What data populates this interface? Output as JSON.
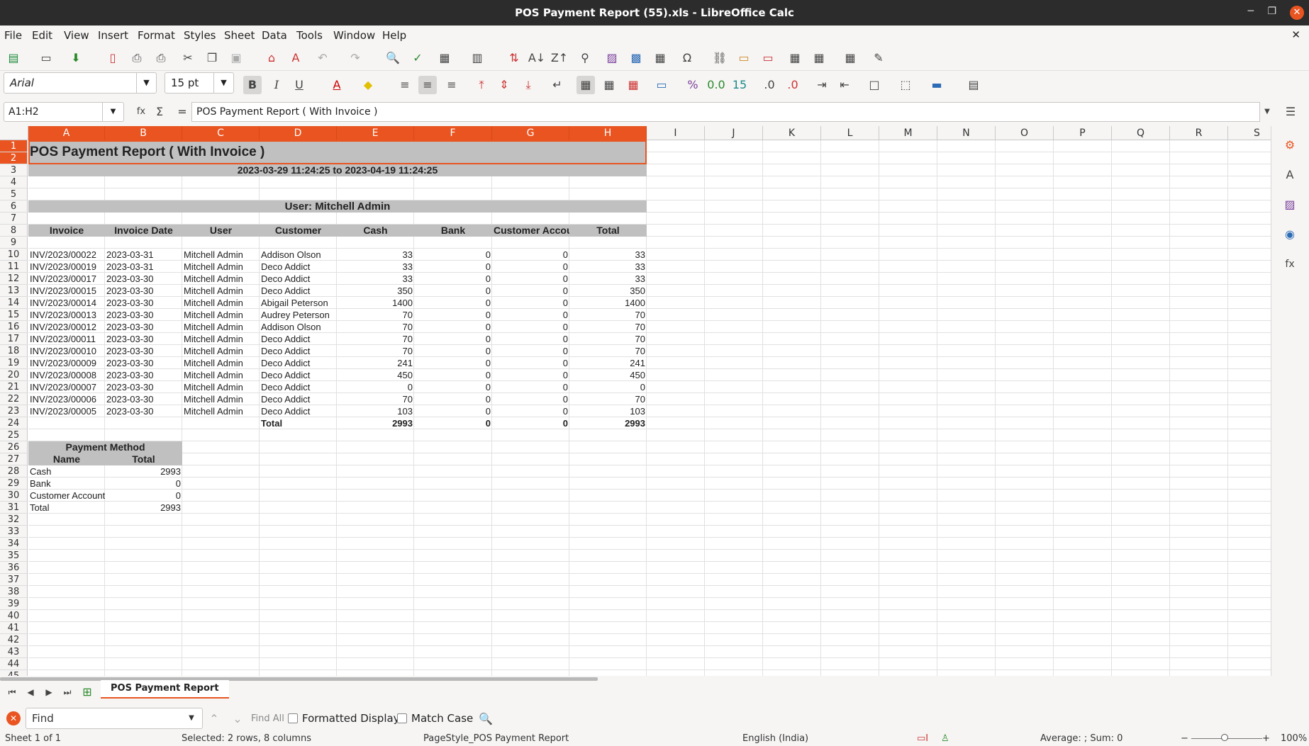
{
  "window": {
    "title": "POS Payment Report (55).xls - LibreOffice Calc"
  },
  "menu": [
    "File",
    "Edit",
    "View",
    "Insert",
    "Format",
    "Styles",
    "Sheet",
    "Data",
    "Tools",
    "Window",
    "Help"
  ],
  "toolbar": {
    "font_name": "Arial",
    "font_size": "15 pt"
  },
  "formula_bar": {
    "cell_ref": "A1:H2",
    "content": "POS Payment Report ( With Invoice )"
  },
  "columns": [
    "A",
    "B",
    "C",
    "D",
    "E",
    "F",
    "G",
    "H",
    "I",
    "J",
    "K",
    "L",
    "M",
    "N",
    "O",
    "P",
    "Q",
    "R",
    "S"
  ],
  "rows": [
    "1",
    "2",
    "3",
    "4",
    "5",
    "6",
    "7",
    "8",
    "9",
    "10",
    "11",
    "12",
    "13",
    "14",
    "15",
    "16",
    "17",
    "18",
    "19",
    "20",
    "21",
    "22",
    "23",
    "24",
    "25",
    "26",
    "27",
    "28",
    "29",
    "30",
    "31",
    "32",
    "33",
    "34",
    "35",
    "36",
    "37",
    "38",
    "39",
    "40",
    "41",
    "42",
    "43",
    "44",
    "45"
  ],
  "report": {
    "title": "POS Payment Report ( With Invoice )",
    "date_range": "2023-03-29 11:24:25 to 2023-04-19 11:24:25",
    "user_line": "User: Mitchell Admin",
    "headers": [
      "Invoice",
      "Invoice Date",
      "User",
      "Customer",
      "Cash",
      "Bank",
      "Customer Account",
      "Total"
    ],
    "rows": [
      [
        "INV/2023/00022",
        "2023-03-31",
        "Mitchell Admin",
        "Addison Olson",
        "33",
        "0",
        "0",
        "33"
      ],
      [
        "INV/2023/00019",
        "2023-03-31",
        "Mitchell Admin",
        "Deco Addict",
        "33",
        "0",
        "0",
        "33"
      ],
      [
        "INV/2023/00017",
        "2023-03-30",
        "Mitchell Admin",
        "Deco Addict",
        "33",
        "0",
        "0",
        "33"
      ],
      [
        "INV/2023/00015",
        "2023-03-30",
        "Mitchell Admin",
        "Deco Addict",
        "350",
        "0",
        "0",
        "350"
      ],
      [
        "INV/2023/00014",
        "2023-03-30",
        "Mitchell Admin",
        "Abigail Peterson",
        "1400",
        "0",
        "0",
        "1400"
      ],
      [
        "INV/2023/00013",
        "2023-03-30",
        "Mitchell Admin",
        "Audrey Peterson",
        "70",
        "0",
        "0",
        "70"
      ],
      [
        "INV/2023/00012",
        "2023-03-30",
        "Mitchell Admin",
        "Addison Olson",
        "70",
        "0",
        "0",
        "70"
      ],
      [
        "INV/2023/00011",
        "2023-03-30",
        "Mitchell Admin",
        "Deco Addict",
        "70",
        "0",
        "0",
        "70"
      ],
      [
        "INV/2023/00010",
        "2023-03-30",
        "Mitchell Admin",
        "Deco Addict",
        "70",
        "0",
        "0",
        "70"
      ],
      [
        "INV/2023/00009",
        "2023-03-30",
        "Mitchell Admin",
        "Deco Addict",
        "241",
        "0",
        "0",
        "241"
      ],
      [
        "INV/2023/00008",
        "2023-03-30",
        "Mitchell Admin",
        "Deco Addict",
        "450",
        "0",
        "0",
        "450"
      ],
      [
        "INV/2023/00007",
        "2023-03-30",
        "Mitchell Admin",
        "Deco Addict",
        "0",
        "0",
        "0",
        "0"
      ],
      [
        "INV/2023/00006",
        "2023-03-30",
        "Mitchell Admin",
        "Deco Addict",
        "70",
        "0",
        "0",
        "70"
      ],
      [
        "INV/2023/00005",
        "2023-03-30",
        "Mitchell Admin",
        "Deco Addict",
        "103",
        "0",
        "0",
        "103"
      ]
    ],
    "total_row": {
      "label": "Total",
      "cash": "2993",
      "bank": "0",
      "customer_account": "0",
      "total": "2993"
    },
    "payment_method": {
      "title": "Payment Method",
      "col_name": "Name",
      "col_total": "Total",
      "rows": [
        [
          "Cash",
          "2993"
        ],
        [
          "Bank",
          "0"
        ],
        [
          "Customer Account",
          "0"
        ],
        [
          "Total",
          "2993"
        ]
      ]
    }
  },
  "sheet_tab": "POS Payment Report",
  "find": {
    "placeholder": "Find",
    "find_all": "Find All",
    "formatted_display": "Formatted Display",
    "match_case": "Match Case"
  },
  "status": {
    "sheet": "Sheet 1 of 1",
    "selection": "Selected: 2 rows, 8 columns",
    "page_style": "PageStyle_POS Payment Report",
    "language": "English (India)",
    "sum": "Average: ; Sum: 0",
    "zoom": "100%"
  }
}
